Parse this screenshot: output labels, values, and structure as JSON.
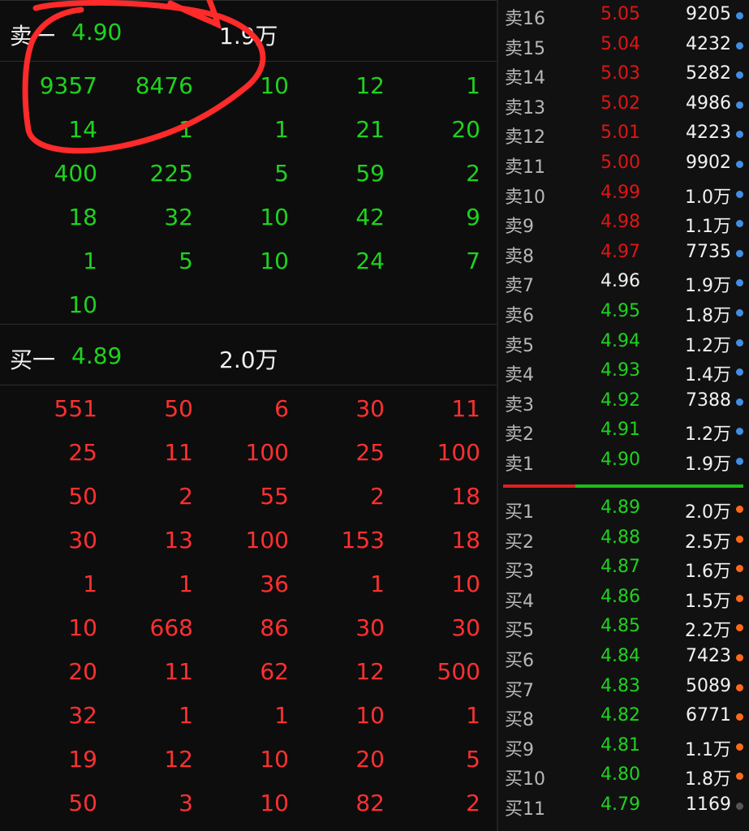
{
  "left": {
    "ask1": {
      "label": "卖一",
      "price": "4.90",
      "volume": "1.9万"
    },
    "ask_orders": [
      [
        "9357",
        "8476",
        "10",
        "12",
        "1"
      ],
      [
        "14",
        "1",
        "1",
        "21",
        "20"
      ],
      [
        "400",
        "225",
        "5",
        "59",
        "2"
      ],
      [
        "18",
        "32",
        "10",
        "42",
        "9"
      ],
      [
        "1",
        "5",
        "10",
        "24",
        "7"
      ],
      [
        "10",
        "",
        "",
        "",
        ""
      ]
    ],
    "bid1": {
      "label": "买一",
      "price": "4.89",
      "volume": "2.0万"
    },
    "bid_orders": [
      [
        "551",
        "50",
        "6",
        "30",
        "11"
      ],
      [
        "25",
        "11",
        "100",
        "25",
        "100"
      ],
      [
        "50",
        "2",
        "55",
        "2",
        "18"
      ],
      [
        "30",
        "13",
        "100",
        "153",
        "18"
      ],
      [
        "1",
        "1",
        "36",
        "1",
        "10"
      ],
      [
        "10",
        "668",
        "86",
        "30",
        "30"
      ],
      [
        "20",
        "11",
        "62",
        "12",
        "500"
      ],
      [
        "32",
        "1",
        "1",
        "10",
        "1"
      ],
      [
        "19",
        "12",
        "10",
        "20",
        "5"
      ],
      [
        "50",
        "3",
        "10",
        "82",
        "2"
      ]
    ]
  },
  "orderbook": {
    "asks": [
      {
        "label": "卖16",
        "price": "5.05",
        "volume": "9205",
        "color": "red"
      },
      {
        "label": "卖15",
        "price": "5.04",
        "volume": "4232",
        "color": "red"
      },
      {
        "label": "卖14",
        "price": "5.03",
        "volume": "5282",
        "color": "red"
      },
      {
        "label": "卖13",
        "price": "5.02",
        "volume": "4986",
        "color": "red"
      },
      {
        "label": "卖12",
        "price": "5.01",
        "volume": "4223",
        "color": "red"
      },
      {
        "label": "卖11",
        "price": "5.00",
        "volume": "9902",
        "color": "red"
      },
      {
        "label": "卖10",
        "price": "4.99",
        "volume": "1.0万",
        "color": "red"
      },
      {
        "label": "卖9",
        "price": "4.98",
        "volume": "1.1万",
        "color": "red"
      },
      {
        "label": "卖8",
        "price": "4.97",
        "volume": "7735",
        "color": "red"
      },
      {
        "label": "卖7",
        "price": "4.96",
        "volume": "1.9万",
        "color": "white"
      },
      {
        "label": "卖6",
        "price": "4.95",
        "volume": "1.8万",
        "color": "green"
      },
      {
        "label": "卖5",
        "price": "4.94",
        "volume": "1.2万",
        "color": "green"
      },
      {
        "label": "卖4",
        "price": "4.93",
        "volume": "1.4万",
        "color": "green"
      },
      {
        "label": "卖3",
        "price": "4.92",
        "volume": "7388",
        "color": "green"
      },
      {
        "label": "卖2",
        "price": "4.91",
        "volume": "1.2万",
        "color": "green"
      },
      {
        "label": "卖1",
        "price": "4.90",
        "volume": "1.9万",
        "color": "green"
      }
    ],
    "bids": [
      {
        "label": "买1",
        "price": "4.89",
        "volume": "2.0万",
        "color": "green",
        "dot": "orange"
      },
      {
        "label": "买2",
        "price": "4.88",
        "volume": "2.5万",
        "color": "green",
        "dot": "orange"
      },
      {
        "label": "买3",
        "price": "4.87",
        "volume": "1.6万",
        "color": "green",
        "dot": "orange"
      },
      {
        "label": "买4",
        "price": "4.86",
        "volume": "1.5万",
        "color": "green",
        "dot": "orange"
      },
      {
        "label": "买5",
        "price": "4.85",
        "volume": "2.2万",
        "color": "green",
        "dot": "orange"
      },
      {
        "label": "买6",
        "price": "4.84",
        "volume": "7423",
        "color": "green",
        "dot": "orange"
      },
      {
        "label": "买7",
        "price": "4.83",
        "volume": "5089",
        "color": "green",
        "dot": "orange"
      },
      {
        "label": "买8",
        "price": "4.82",
        "volume": "6771",
        "color": "green",
        "dot": "orange"
      },
      {
        "label": "买9",
        "price": "4.81",
        "volume": "1.1万",
        "color": "green",
        "dot": "orange"
      },
      {
        "label": "买10",
        "price": "4.80",
        "volume": "1.8万",
        "color": "green",
        "dot": "orange"
      },
      {
        "label": "买11",
        "price": "4.79",
        "volume": "1169",
        "color": "green",
        "dot": "gray"
      }
    ],
    "split_ratio": 0.3
  },
  "colors": {
    "green": "#1fd21f",
    "red": "#ff3030",
    "dark_red": "#e01515",
    "white": "#f0f0f0",
    "ask_dot": "#3f8fe6",
    "bid_dot": "#ff6a1a",
    "gray_dot": "#555555",
    "annotation": "#ff2a2a"
  }
}
